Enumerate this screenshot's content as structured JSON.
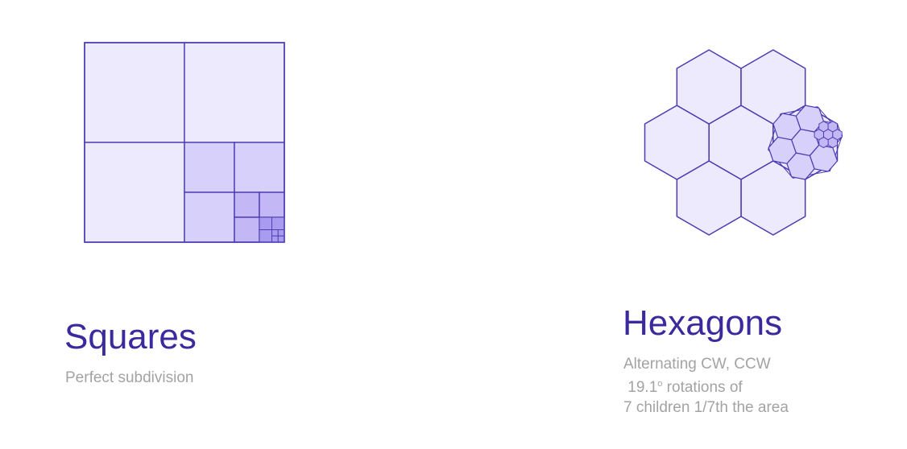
{
  "colors": {
    "stroke": "#4a3bb0",
    "fill_light": "#eeeafd",
    "fill_mid": "#d7d0fb",
    "fill_deep": "#c3b7f6",
    "fill_deepest": "#a99cf0",
    "title": "#3b2a9e",
    "subtitle": "#a3a3a3"
  },
  "squares": {
    "title": "Squares",
    "subtitle": "Perfect subdivision"
  },
  "hexagons": {
    "title": "Hexagons",
    "subtitle_lines": [
      "Alternating CW, CCW",
      " 19.1",
      " rotations of",
      "7 children 1/7th the area"
    ],
    "degree_mark": "o",
    "rotation_deg": 19.1,
    "children_count": 7
  }
}
